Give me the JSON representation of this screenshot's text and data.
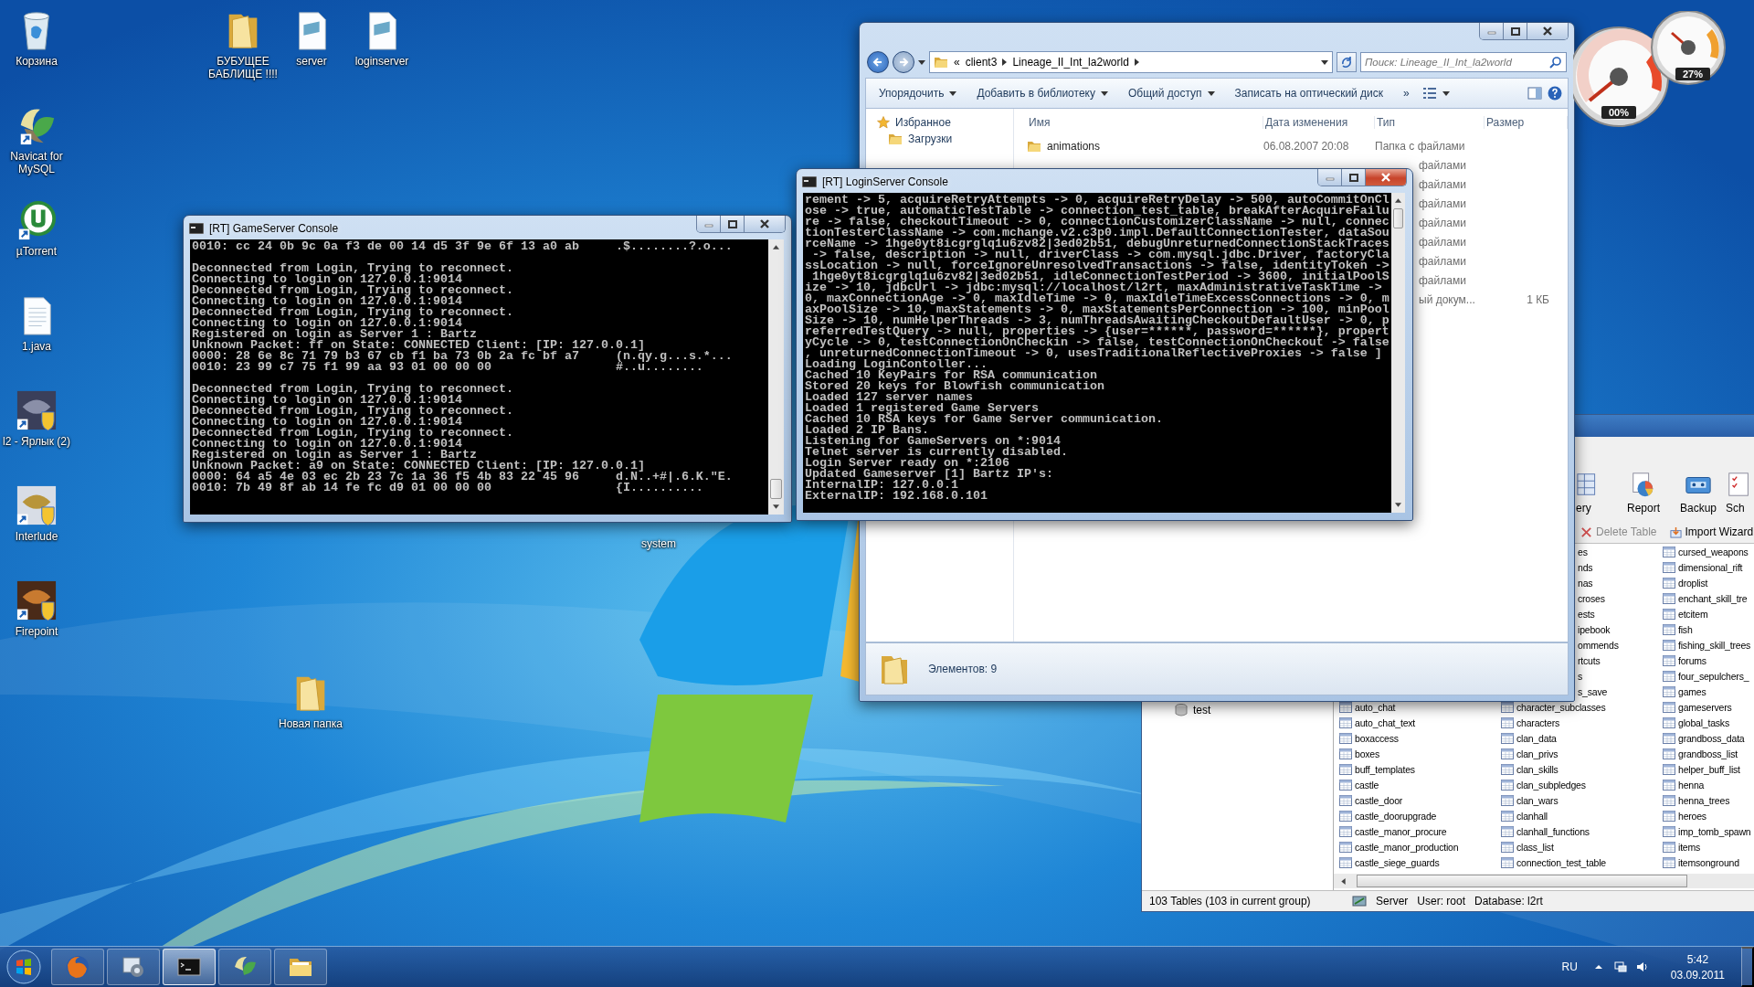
{
  "desktop_icons": [
    {
      "label": "Корзина",
      "kind": "recycle_bin"
    },
    {
      "label": "БУБУЩЕЕ БАБЛИЩЕ !!!!",
      "kind": "folder"
    },
    {
      "label": "server",
      "kind": "script"
    },
    {
      "label": "loginserver",
      "kind": "script"
    },
    {
      "label": "Navicat for MySQL",
      "kind": "navicat"
    },
    {
      "label": "µTorrent",
      "kind": "utorrent"
    },
    {
      "label": "1.java",
      "kind": "text_file"
    },
    {
      "label": "l2 - Ярлык (2)",
      "kind": "game_shortcut"
    },
    {
      "label": "Interlude",
      "kind": "game_shortcut"
    },
    {
      "label": "Firepoint",
      "kind": "game_shortcut"
    },
    {
      "label": "Новая папка",
      "kind": "folder"
    },
    {
      "label": "system",
      "kind": "covered"
    }
  ],
  "navicat": {
    "toolbar": [
      {
        "label": "ery",
        "kind": "query"
      },
      {
        "label": "Report",
        "kind": "report"
      },
      {
        "label": "Backup",
        "kind": "backup"
      },
      {
        "label": "Sch",
        "kind": "schedule"
      }
    ],
    "actions": [
      {
        "label": "Delete Table",
        "kind": "delete",
        "disabled": true
      },
      {
        "label": "Import Wizard",
        "kind": "import",
        "disabled": false
      }
    ],
    "tree": [
      {
        "label": "test"
      }
    ],
    "table_columns": [
      {
        "items": [
          {
            "label": "auto_chat",
            "kind": "table"
          },
          {
            "label": "auto_chat_text",
            "kind": "table"
          },
          {
            "label": "boxaccess",
            "kind": "table"
          },
          {
            "label": "boxes",
            "kind": "table"
          },
          {
            "label": "buff_templates",
            "kind": "table"
          },
          {
            "label": "castle",
            "kind": "table"
          },
          {
            "label": "castle_door",
            "kind": "table"
          },
          {
            "label": "castle_doorupgrade",
            "kind": "table"
          },
          {
            "label": "castle_manor_procure",
            "kind": "table"
          },
          {
            "label": "castle_manor_production",
            "kind": "table"
          },
          {
            "label": "castle_siege_guards",
            "kind": "table"
          }
        ]
      },
      {
        "items": [
          {
            "label": "es",
            "kind": "partial"
          },
          {
            "label": "nds",
            "kind": "partial"
          },
          {
            "label": "nas",
            "kind": "partial"
          },
          {
            "label": "croses",
            "kind": "partial"
          },
          {
            "label": "ests",
            "kind": "partial"
          },
          {
            "label": "ipebook",
            "kind": "partial"
          },
          {
            "label": "ommends",
            "kind": "partial"
          },
          {
            "label": "rtcuts",
            "kind": "partial"
          },
          {
            "label": "s",
            "kind": "partial"
          },
          {
            "label": "s_save",
            "kind": "partial"
          },
          {
            "label": "character_subclasses",
            "kind": "table"
          },
          {
            "label": "characters",
            "kind": "table"
          },
          {
            "label": "clan_data",
            "kind": "table"
          },
          {
            "label": "clan_privs",
            "kind": "table"
          },
          {
            "label": "clan_skills",
            "kind": "table"
          },
          {
            "label": "clan_subpledges",
            "kind": "table"
          },
          {
            "label": "clan_wars",
            "kind": "table"
          },
          {
            "label": "clanhall",
            "kind": "table"
          },
          {
            "label": "clanhall_functions",
            "kind": "table"
          },
          {
            "label": "class_list",
            "kind": "table"
          },
          {
            "label": "connection_test_table",
            "kind": "table"
          }
        ]
      },
      {
        "items": [
          {
            "label": "cursed_weapons",
            "kind": "table"
          },
          {
            "label": "dimensional_rift",
            "kind": "table"
          },
          {
            "label": "droplist",
            "kind": "table"
          },
          {
            "label": "enchant_skill_tre",
            "kind": "table"
          },
          {
            "label": "etcitem",
            "kind": "table"
          },
          {
            "label": "fish",
            "kind": "table"
          },
          {
            "label": "fishing_skill_trees",
            "kind": "table"
          },
          {
            "label": "forums",
            "kind": "table"
          },
          {
            "label": "four_sepulchers_",
            "kind": "table"
          },
          {
            "label": "games",
            "kind": "table"
          },
          {
            "label": "gameservers",
            "kind": "table"
          },
          {
            "label": "global_tasks",
            "kind": "table"
          },
          {
            "label": "grandboss_data",
            "kind": "table"
          },
          {
            "label": "grandboss_list",
            "kind": "table"
          },
          {
            "label": "helper_buff_list",
            "kind": "table"
          },
          {
            "label": "henna",
            "kind": "table"
          },
          {
            "label": "henna_trees",
            "kind": "table"
          },
          {
            "label": "heroes",
            "kind": "table"
          },
          {
            "label": "imp_tomb_spawn",
            "kind": "table"
          },
          {
            "label": "items",
            "kind": "table"
          },
          {
            "label": "itemsonground",
            "kind": "table"
          }
        ]
      }
    ],
    "status": {
      "tables": "103 Tables (103 in current group)",
      "server": "Server",
      "user": "User: root",
      "database": "Database: l2rt"
    }
  },
  "explorer": {
    "active": false,
    "address": {
      "overflow": "«",
      "crumbs": [
        "client3",
        "Lineage_II_Int_la2world"
      ]
    },
    "search": {
      "placeholder": "Поиск: Lineage_II_Int_la2world"
    },
    "commands": [
      {
        "label": "Упорядочить",
        "dropdown": true
      },
      {
        "label": "Добавить в библиотеку",
        "dropdown": true
      },
      {
        "label": "Общий доступ",
        "dropdown": true
      },
      {
        "label": "Записать на оптический диск",
        "dropdown": false
      },
      {
        "label": "»",
        "dropdown": false
      }
    ],
    "nav": [
      {
        "label": "Избранное",
        "kind": "favorites"
      },
      {
        "label": "Загрузки",
        "kind": "downloads"
      }
    ],
    "columns": [
      "Имя",
      "Дата изменения",
      "Тип",
      "Размер"
    ],
    "rows": [
      {
        "kind": "full",
        "name": "animations",
        "date": "06.08.2007 20:08",
        "type": "Папка с файлами"
      },
      {
        "kind": "partial",
        "type": "файлами"
      },
      {
        "kind": "partial",
        "type": "файлами"
      },
      {
        "kind": "partial",
        "type": "файлами"
      },
      {
        "kind": "partial",
        "type": "файлами"
      },
      {
        "kind": "partial",
        "type": "файлами"
      },
      {
        "kind": "partial",
        "type": "файлами"
      },
      {
        "kind": "partial",
        "type": "файлами"
      },
      {
        "kind": "partial",
        "type": "ый докум...",
        "size": "1 КБ"
      }
    ],
    "status": "Элементов: 9"
  },
  "gadget": {
    "gauges": [
      {
        "reading": "00%"
      },
      {
        "reading": "27%"
      }
    ]
  },
  "game_console": {
    "title": "[RT] GameServer Console",
    "active": false,
    "blocks": [
      [
        "0010: cc 24 0b 9c 0a f3 de 00 14 d5 3f 9e 6f 13 a0 ab     .$........?.o..."
      ],
      [
        "Deconnected from Login, Trying to reconnect.",
        "Connecting to login on 127.0.0.1:9014",
        "Deconnected from Login, Trying to reconnect.",
        "Connecting to login on 127.0.0.1:9014",
        "Deconnected from Login, Trying to reconnect.",
        "Connecting to login on 127.0.0.1:9014",
        "Registered on login as Server 1 : Bartz",
        "Unknown Packet: ff on State: CONNECTED Client: [IP: 127.0.0.1]",
        "0000: 28 6e 8c 71 79 b3 67 cb f1 ba 73 0b 2a fc bf a7     (n.qy.g...s.*...",
        "0010: 23 99 c7 75 f1 99 aa 93 01 00 00 00                 #..u........"
      ],
      [
        "Deconnected from Login, Trying to reconnect.",
        "Connecting to login on 127.0.0.1:9014",
        "Deconnected from Login, Trying to reconnect.",
        "Connecting to login on 127.0.0.1:9014",
        "Deconnected from Login, Trying to reconnect.",
        "Connecting to login on 127.0.0.1:9014",
        "Registered on login as Server 1 : Bartz",
        "Unknown Packet: a9 on State: CONNECTED Client: [IP: 127.0.0.1]",
        "0000: 64 a5 4e 03 ec 2b 23 7c 1a 36 f5 4b 83 22 45 96     d.N..+#|.6.K.\"E.",
        "0010: 7b 49 8f ab 14 fe fc d9 01 00 00 00                 {I.........."
      ]
    ]
  },
  "login_console": {
    "title": "[RT] LoginServer Console",
    "active": true,
    "blocks": [
      [
        "rement -> 5, acquireRetryAttempts -> 0, acquireRetryDelay -> 500, autoCommitOnCl",
        "ose -> true, automaticTestTable -> connection_test_table, breakAfterAcquireFailu",
        "re -> false, checkoutTimeout -> 0, connectionCustomizerClassName -> null, connec",
        "tionTesterClassName -> com.mchange.v2.c3p0.impl.DefaultConnectionTester, dataSou",
        "rceName -> 1hge0yt8icgrglq1u6zv82|3ed02b51, debugUnreturnedConnectionStackTraces",
        " -> false, description -> null, driverClass -> com.mysql.jdbc.Driver, factoryCla",
        "ssLocation -> null, forceIgnoreUnresolvedTransactions -> false, identityToken ->",
        " 1hge0yt8icgrglq1u6zv82|3ed02b51, idleConnectionTestPeriod -> 3600, initialPoolS",
        "ize -> 10, jdbcUrl -> jdbc:mysql://localhost/l2rt, maxAdministrativeTaskTime ->",
        "0, maxConnectionAge -> 0, maxIdleTime -> 0, maxIdleTimeExcessConnections -> 0, m",
        "axPoolSize -> 10, maxStatements -> 0, maxStatementsPerConnection -> 100, minPool",
        "Size -> 10, numHelperThreads -> 3, numThreadsAwaitingCheckoutDefaultUser -> 0, p",
        "referredTestQuery -> null, properties -> {user=******, password=******}, propert",
        "yCycle -> 0, testConnectionOnCheckin -> false, testConnectionOnCheckout -> false",
        ", unreturnedConnectionTimeout -> 0, usesTraditionalReflectiveProxies -> false ]",
        "Loading LoginContoller...",
        "Cached 10 KeyPairs for RSA communication",
        "Stored 20 keys for Blowfish communication",
        "Loaded 127 server names",
        "Loaded 1 registered Game Servers",
        "Cached 10 RSA keys for Game Server communication.",
        "Loaded 2 IP Bans.",
        "Listening for GameServers on *:9014",
        "Telnet server is currently disabled.",
        "Login Server ready on *:2106",
        "Updated Gameserver [1] Bartz IP's:",
        "InternalIP: 127.0.0.1",
        "ExternalIP: 192.168.0.101"
      ]
    ]
  },
  "taskbar": {
    "items": [
      {
        "kind": "firefox",
        "selected": false
      },
      {
        "kind": "control_panel",
        "selected": false
      },
      {
        "kind": "console",
        "selected": true
      },
      {
        "kind": "navicat",
        "selected": false
      },
      {
        "kind": "explorer",
        "selected": false
      }
    ],
    "tray": {
      "language": "RU",
      "time": "5:42",
      "date": "03.09.2011"
    }
  }
}
